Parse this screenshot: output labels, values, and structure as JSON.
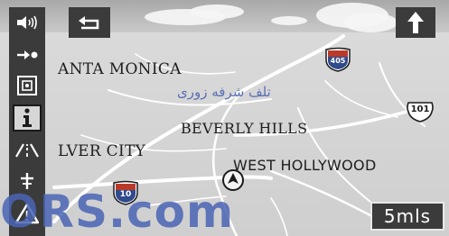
{
  "map": {
    "places": {
      "santa_monica": "ANTA MONICA",
      "beverly_hills": "BEVERLY HILLS",
      "culver_city": "LVER CITY",
      "west_hollywood": "WEST HOLLYWOOD"
    },
    "highways": {
      "i405": "405",
      "us101": "101",
      "i10": "10"
    }
  },
  "scale_button": {
    "label": "5mls"
  },
  "sidebar": {
    "items": [
      {
        "icon": "speaker-icon"
      },
      {
        "icon": "route-arrow-icon"
      },
      {
        "icon": "map-grid-icon"
      },
      {
        "icon": "info-icon",
        "active": true
      },
      {
        "icon": "road-icon"
      },
      {
        "icon": "junction-icon"
      },
      {
        "icon": "warning-icon"
      }
    ]
  },
  "watermark": {
    "text": "تلف شرفه زوری",
    "com": "ORS.com"
  },
  "colors": {
    "panel": "#3b3b3b",
    "map_bg": "#d6d6d6",
    "road": "#ffffff",
    "watermark": "#4b65b5"
  }
}
